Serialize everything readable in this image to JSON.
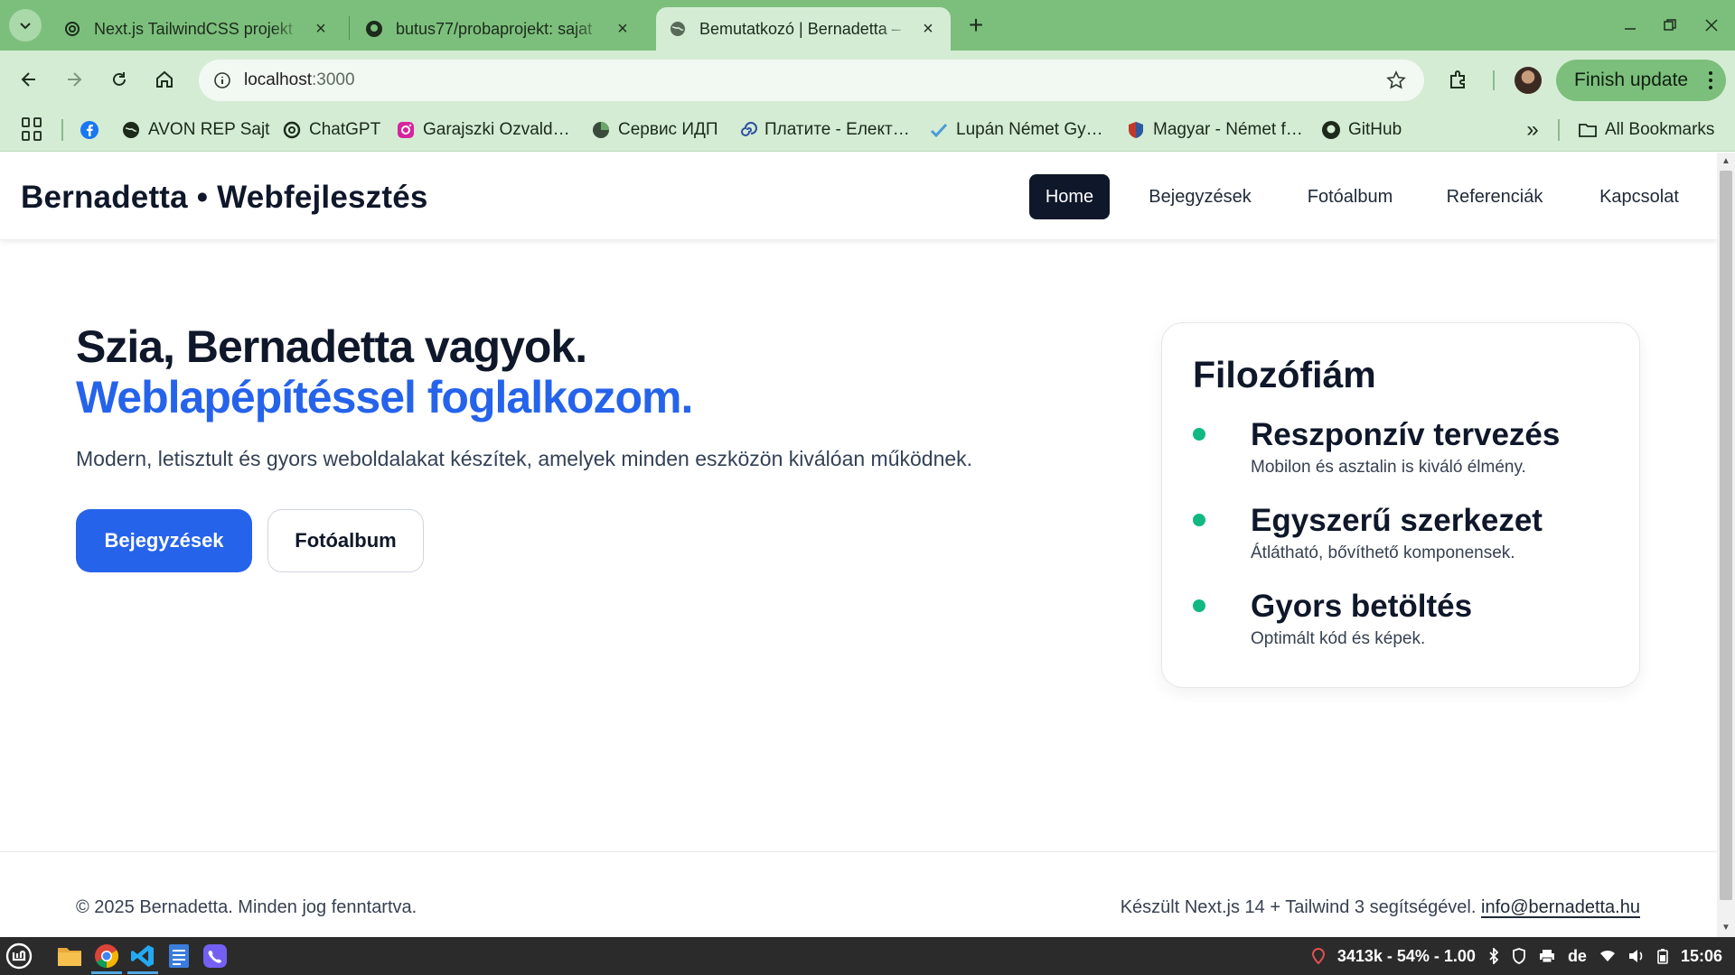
{
  "browser": {
    "tabs": [
      {
        "title": "Next.js TailwindCSS projekt",
        "icon": "openai-icon",
        "active": false
      },
      {
        "title": "butus77/probaprojekt: sajat",
        "icon": "github-icon",
        "active": false
      },
      {
        "title": "Bemutatkozó | Bernadetta – ",
        "icon": "globe-icon",
        "active": true
      }
    ],
    "url_host": "localhost",
    "url_port": ":3000",
    "finish_update_label": "Finish update",
    "bookmarks": [
      {
        "label": "",
        "icon": "facebook-icon"
      },
      {
        "label": "AVON REP Sajt",
        "icon": "globe-icon"
      },
      {
        "label": "ChatGPT",
        "icon": "openai-icon"
      },
      {
        "label": "Garajszki Ozvald…",
        "icon": "instagram-icon"
      },
      {
        "label": "Сервис ИДП",
        "icon": "pie-icon"
      },
      {
        "label": "Платите - Елект…",
        "icon": "spiral-icon"
      },
      {
        "label": "Lupán Német Gy…",
        "icon": "check-icon"
      },
      {
        "label": "Magyar - Német f…",
        "icon": "shield-icon"
      },
      {
        "label": "GitHub",
        "icon": "github-icon"
      }
    ],
    "all_bookmarks_label": "All Bookmarks"
  },
  "site": {
    "brand": "Bernadetta • Webfejlesztés",
    "nav": [
      {
        "label": "Home",
        "active": true
      },
      {
        "label": "Bejegyzések",
        "active": false
      },
      {
        "label": "Fotóalbum",
        "active": false
      },
      {
        "label": "Referenciák",
        "active": false
      },
      {
        "label": "Kapcsolat",
        "active": false
      }
    ],
    "hero": {
      "title_line1": "Szia, Bernadetta vagyok.",
      "title_line2": "Weblapépítéssel foglalkozom.",
      "lead": "Modern, letisztult és gyors weboldalakat készítek, amelyek minden eszközön kiválóan működnek.",
      "primary_button": "Bejegyzések",
      "secondary_button": "Fotóalbum"
    },
    "philosophy": {
      "title": "Filozófiám",
      "items": [
        {
          "title": "Reszponzív tervezés",
          "desc": "Mobilon és asztalin is kiváló élmény."
        },
        {
          "title": "Egyszerű szerkezet",
          "desc": "Átlátható, bővíthető komponensek."
        },
        {
          "title": "Gyors betöltés",
          "desc": "Optimált kód és képek."
        }
      ]
    },
    "footer": {
      "copyright": "© 2025 Bernadetta. Minden jog fenntartva.",
      "built_with": "Készült Next.js 14 + Tailwind 3 segítségével.",
      "email": "info@bernadetta.hu"
    }
  },
  "taskbar": {
    "apps": [
      "mint-menu-icon",
      "files-icon",
      "chrome-icon",
      "vscode-icon",
      "text-editor-icon",
      "viber-icon"
    ],
    "system_stats": "3413k - 54% - 1.00",
    "keyboard_layout": "de",
    "time": "15:06"
  },
  "colors": {
    "browser_frame": "#7cbf7c",
    "browser_toolbar": "#d4ecd4",
    "brand_dark": "#0f172a",
    "accent_blue": "#2563eb",
    "bullet_green": "#10b981"
  }
}
